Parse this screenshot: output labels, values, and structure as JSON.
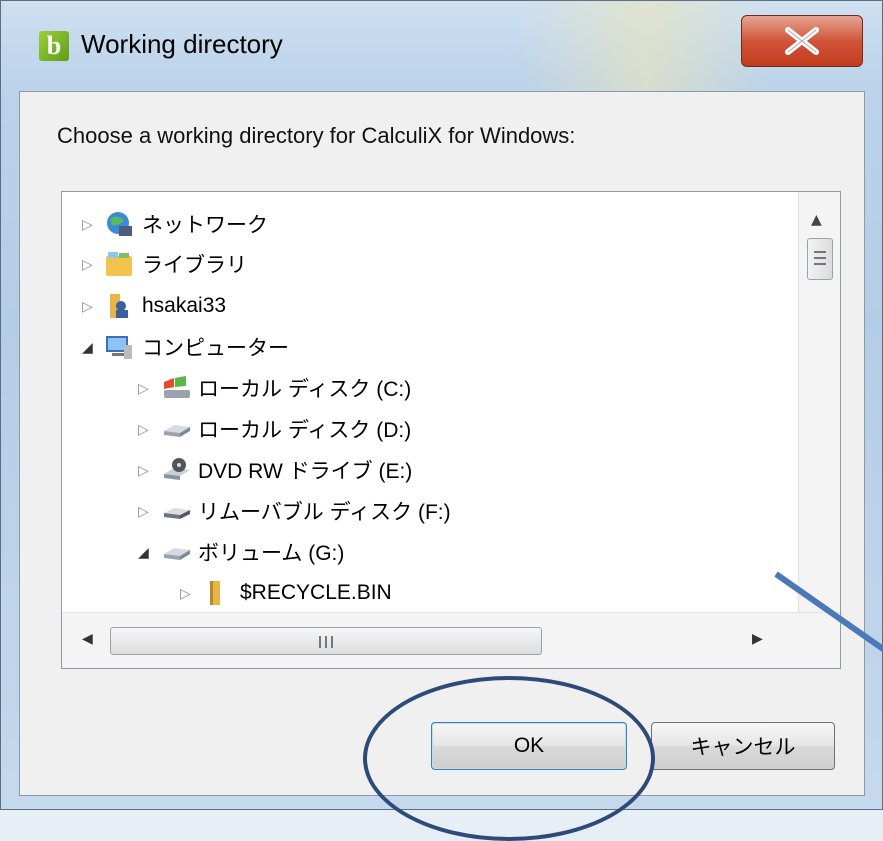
{
  "window": {
    "title": "Working directory",
    "app_icon_letter": "b",
    "close_label": "X"
  },
  "dialog": {
    "prompt": "Choose a working directory for CalculiX for Windows:"
  },
  "tree": {
    "items": [
      {
        "label": "ネットワーク",
        "icon": "network-icon",
        "expanded": false
      },
      {
        "label": "ライブラリ",
        "icon": "library-icon",
        "expanded": false
      },
      {
        "label": "hsakai33",
        "icon": "user-folder-icon",
        "expanded": false
      },
      {
        "label": "コンピューター",
        "icon": "computer-icon",
        "expanded": true
      },
      {
        "label": "ローカル ディスク (C:)",
        "icon": "system-drive-icon",
        "expanded": false
      },
      {
        "label": "ローカル ディスク (D:)",
        "icon": "hard-drive-icon",
        "expanded": false
      },
      {
        "label": "DVD RW ドライブ (E:)",
        "icon": "dvd-drive-icon",
        "expanded": false
      },
      {
        "label": "リムーバブル ディスク (F:)",
        "icon": "removable-drive-icon",
        "expanded": false
      },
      {
        "label": "ボリューム (G:)",
        "icon": "hard-drive-icon",
        "expanded": true
      },
      {
        "label": "$RECYCLE.BIN",
        "icon": "folder-icon",
        "expanded": false
      }
    ]
  },
  "buttons": {
    "ok": "OK",
    "cancel": "キャンセル"
  },
  "colors": {
    "annotation_ellipse": "#2e4a79",
    "annotation_arrow": "#4a78b8",
    "close_button": "#c23b1e"
  }
}
